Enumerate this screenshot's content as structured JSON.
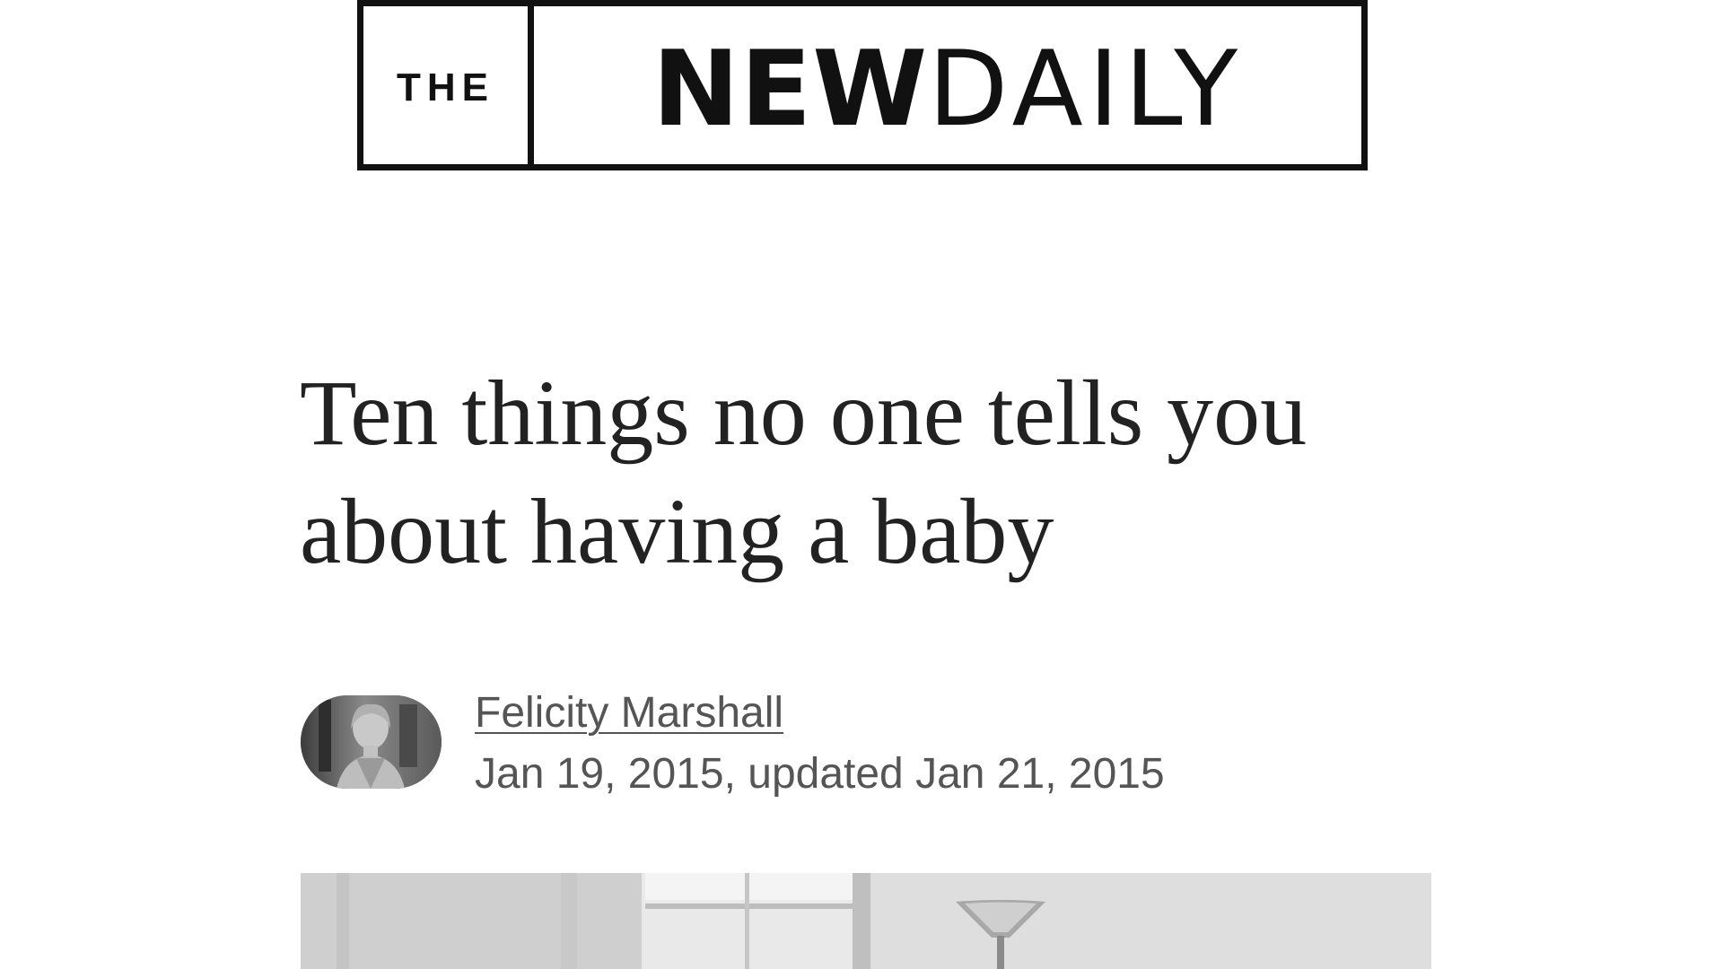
{
  "masthead": {
    "logo_the": "THE",
    "logo_new": "NEW",
    "logo_daily": "DAILY"
  },
  "article": {
    "headline_line1": "Ten things no one tells you",
    "headline_line2": "about having a baby",
    "author": "Felicity Marshall",
    "dates": "Jan 19, 2015, updated Jan 21, 2015"
  },
  "colors": {
    "logo_ink": "#111111",
    "headline_text": "#222222",
    "meta_text": "#555555",
    "background": "#ffffff"
  }
}
